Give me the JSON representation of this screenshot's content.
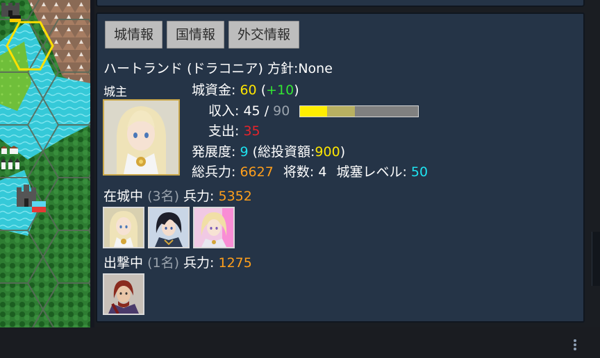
{
  "tabs": [
    "城情報",
    "国情報",
    "外交情報"
  ],
  "castle": {
    "name": "ハートランド",
    "country": "(ドラコニア)",
    "policy_label": "方針:",
    "policy_value": "None"
  },
  "lord_label": "城主",
  "stats": {
    "funds_label": "城資金:",
    "funds_value": "60",
    "funds_delta": "+10",
    "income_label": "収入:",
    "income_value": "45",
    "income_sep": "/",
    "income_max": "90",
    "income_bar_yellow_fraction": 0.23,
    "income_bar_olive_fraction": 0.23,
    "expense_label": "支出:",
    "expense_value": "35",
    "development_label": "発展度:",
    "development_value": "9",
    "invest_label": "(総投資額:",
    "invest_value": "900",
    "invest_close": ")",
    "troops_label": "総兵力:",
    "troops_value": "6627",
    "generals_label": "将数:",
    "generals_value": "4",
    "fort_label": "城塞レベル:",
    "fort_value": "50"
  },
  "garrison": {
    "label": "在城中",
    "count": "(3名)",
    "troops_label": "兵力:",
    "troops_value": "5352"
  },
  "sortie": {
    "label": "出撃中",
    "count": "(1名)",
    "troops_label": "兵力:",
    "troops_value": "1275"
  },
  "colors": {
    "panel": "#253447",
    "yellow": "#ffe600",
    "green": "#33e533",
    "red": "#e6242b",
    "cyan": "#1ee3f0",
    "orange": "#ff9f1c",
    "hex_highlight": "#ffe000"
  },
  "icons": [
    "castle-icon",
    "village-icon",
    "flag-icon",
    "more-vertical-icon"
  ]
}
